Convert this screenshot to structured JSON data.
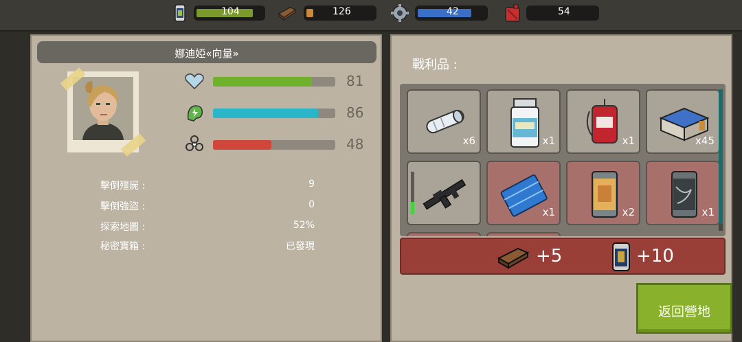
{
  "resources": [
    {
      "icon": "battery-icon",
      "value": "104",
      "level": 0.85,
      "color": "#7a9a2a"
    },
    {
      "icon": "wood-plank-icon",
      "value": "126",
      "level": 0.1,
      "color": "#c98a3a"
    },
    {
      "icon": "gear-parts-icon",
      "value": "42",
      "level": 0.8,
      "color": "#3a6fc9"
    },
    {
      "icon": "fuel-can-icon",
      "value": "54",
      "level": 0.0,
      "color": "#c93a3a"
    }
  ],
  "character": {
    "name": "娜迪婭«向量»",
    "stats": [
      {
        "icon": "heart-icon",
        "value": "81",
        "level": 0.81,
        "color": "#6fb12a"
      },
      {
        "icon": "energy-icon",
        "value": "86",
        "level": 0.86,
        "color": "#2ab5c9"
      },
      {
        "icon": "radiation-icon",
        "value": "48",
        "level": 0.48,
        "color": "#d0463a"
      }
    ]
  },
  "kill_stats": [
    {
      "label": "擊倒殭屍 :",
      "value": "9"
    },
    {
      "label": "擊倒強盜 :",
      "value": "0"
    },
    {
      "label": "探索地圖 :",
      "value": "52%"
    },
    {
      "label": "秘密寶箱 :",
      "value": "已發現"
    }
  ],
  "loot": {
    "title": "戰利品 :",
    "items": [
      {
        "icon": "bandage-roll-icon",
        "qty": "x6",
        "style": "gray"
      },
      {
        "icon": "pill-bottle-icon",
        "qty": "x1",
        "style": "gray"
      },
      {
        "icon": "blood-bag-icon",
        "qty": "x1",
        "style": "gray"
      },
      {
        "icon": "ammo-box-icon",
        "qty": "x45",
        "style": "gray"
      },
      {
        "icon": "rifle-icon",
        "qty": "",
        "style": "gray"
      },
      {
        "icon": "blue-cloth-icon",
        "qty": "x1",
        "style": "red"
      },
      {
        "icon": "canned-food-icon",
        "qty": "x2",
        "style": "red"
      },
      {
        "icon": "metal-can-icon",
        "qty": "x1",
        "style": "red"
      }
    ]
  },
  "reward": {
    "items": [
      {
        "icon": "wood-plank-icon",
        "value": "+5"
      },
      {
        "icon": "battery-icon",
        "value": "+10"
      }
    ]
  },
  "back_button": {
    "label": "返回營地"
  }
}
